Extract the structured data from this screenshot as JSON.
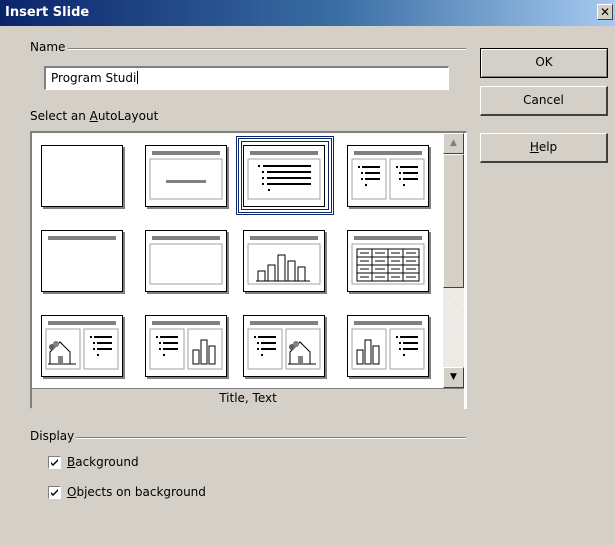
{
  "window": {
    "title": "Insert Slide",
    "close_glyph": "✕"
  },
  "name_section": {
    "label": "Name",
    "value": "Program Studi"
  },
  "autolayout": {
    "label_prefix": "Select an ",
    "label_accel": "A",
    "label_suffix": "utoLayout",
    "selected_caption": "Title, Text",
    "layouts": [
      {
        "kind": "blank"
      },
      {
        "kind": "title-slide"
      },
      {
        "kind": "title-text",
        "selected": true
      },
      {
        "kind": "title-2text"
      },
      {
        "kind": "title-only"
      },
      {
        "kind": "title-content"
      },
      {
        "kind": "title-chart"
      },
      {
        "kind": "title-table"
      },
      {
        "kind": "title-clipart-text"
      },
      {
        "kind": "title-text-chart"
      },
      {
        "kind": "title-text-clipart"
      },
      {
        "kind": "title-chart-text"
      }
    ]
  },
  "buttons": {
    "ok": "OK",
    "cancel": "Cancel",
    "help_accel": "H",
    "help_rest": "elp"
  },
  "display_section": {
    "label": "Display",
    "background": {
      "accel": "B",
      "rest": "ackground",
      "checked": true
    },
    "objects": {
      "accel": "O",
      "rest": "bjects on background",
      "checked": true
    }
  },
  "scrollbar": {
    "up_icon": "arrow-up-icon",
    "down_icon": "arrow-down-icon"
  },
  "colors": {
    "title_bar_start": "#0a246a",
    "title_bar_end": "#a6caf0",
    "dialog": "#d4d0c8",
    "selection": "#0a246a"
  }
}
